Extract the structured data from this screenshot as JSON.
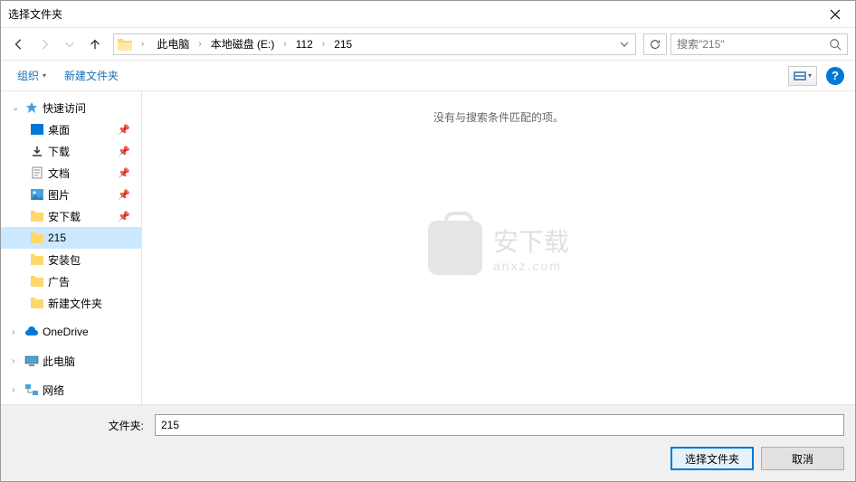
{
  "window": {
    "title": "选择文件夹"
  },
  "breadcrumb": {
    "items": [
      "此电脑",
      "本地磁盘 (E:)",
      "112",
      "215"
    ]
  },
  "search": {
    "placeholder": "搜索\"215\""
  },
  "toolbar": {
    "organize": "组织",
    "newfolder": "新建文件夹"
  },
  "sidebar": {
    "quick": "快速访问",
    "desktop": "桌面",
    "downloads": "下载",
    "documents": "文档",
    "pictures": "图片",
    "anxiazai": "安下载",
    "f215": "215",
    "anzhuangbao": "安装包",
    "guanggao": "广告",
    "xinjian": "新建文件夹",
    "onedrive": "OneDrive",
    "thispc": "此电脑",
    "network": "网络"
  },
  "content": {
    "empty": "没有与搜索条件匹配的项。",
    "watermark_main": "安下载",
    "watermark_sub": "anxz.com"
  },
  "footer": {
    "label": "文件夹:",
    "value": "215",
    "select": "选择文件夹",
    "cancel": "取消"
  }
}
